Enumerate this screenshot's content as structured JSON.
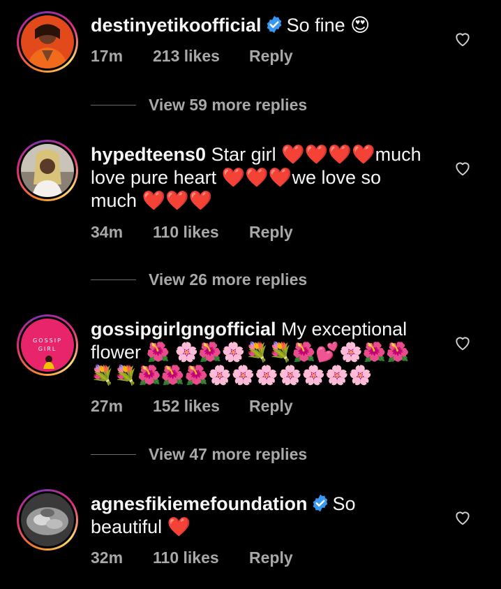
{
  "comments": [
    {
      "username": "destinyetikoofficial",
      "verified": true,
      "text": "So fine 😍",
      "time": "17m",
      "likes": "213 likes",
      "reply": "Reply",
      "view_replies": "View 59 more replies"
    },
    {
      "username": "hypedteens0",
      "verified": false,
      "text_lines": [
        "Star girl ❤️❤️❤️❤️much",
        "love pure heart ❤️❤️❤️we love so",
        "much ❤️❤️❤️"
      ],
      "time": "34m",
      "likes": "110 likes",
      "reply": "Reply",
      "view_replies": "View 26 more replies"
    },
    {
      "username": "gossipgirlgngofficial",
      "verified": false,
      "text_lines": [
        "My exceptional",
        "flower 🌺 🌸🌺🌸💐💐🌺💕🌸🌺🌺",
        "💐💐🌺🌺🌺🌸🌸🌸🌸🌸🌸🌸"
      ],
      "avatar_text": [
        "GOSSIP",
        "GIRL"
      ],
      "time": "27m",
      "likes": "152 likes",
      "reply": "Reply",
      "view_replies": "View 47 more replies"
    },
    {
      "username": "agnesfikiemefoundation",
      "verified": true,
      "text_lines": [
        "So",
        "beautiful ❤️"
      ],
      "time": "32m",
      "likes": "110 likes",
      "reply": "Reply"
    }
  ],
  "icons": {
    "verified": "verified-badge-icon",
    "like": "heart-outline-icon"
  },
  "colors": {
    "background": "#000000",
    "verified": "#3897f0",
    "muted": "#a8a8a8",
    "heart": "#ed1c24"
  }
}
